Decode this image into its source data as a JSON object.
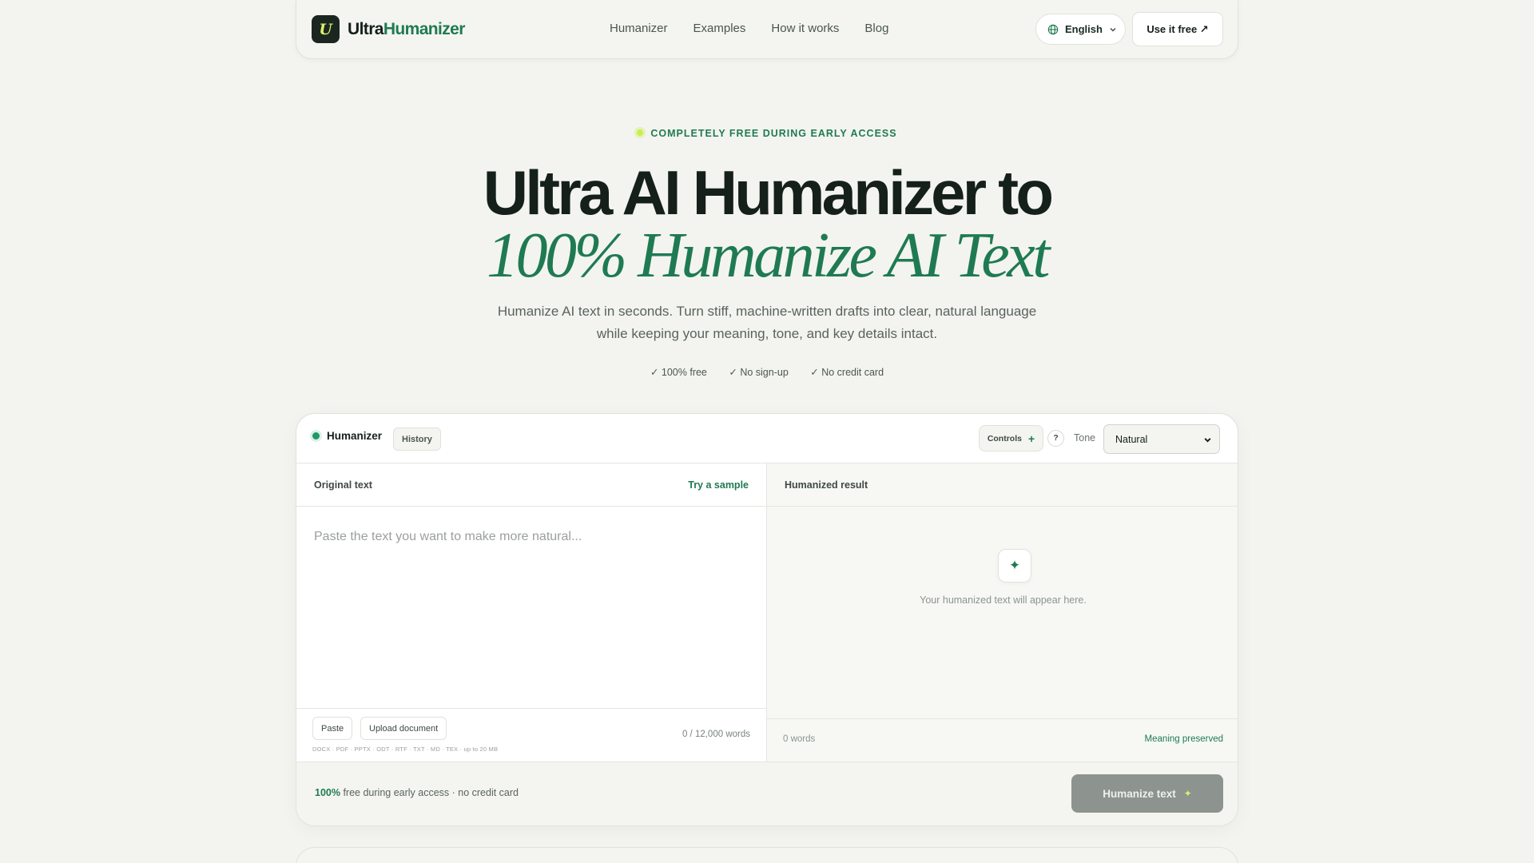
{
  "brand": {
    "logo_letter": "U",
    "name_part1": "Ultra",
    "name_part2": "Humanizer"
  },
  "nav": {
    "links": [
      "Humanizer",
      "Examples",
      "How it works",
      "Blog"
    ]
  },
  "header": {
    "language": "English",
    "cta": "Use it free ↗"
  },
  "hero": {
    "eyebrow": "COMPLETELY FREE DURING EARLY ACCESS",
    "title_line1": "Ultra AI Humanizer to",
    "title_line2": "100% Humanize AI Text",
    "subtitle": "Humanize AI text in seconds. Turn stiff, machine-written drafts into clear, natural language while keeping your meaning, tone, and key details intact.",
    "checks": [
      "✓ 100% free",
      "✓ No sign-up",
      "✓ No credit card"
    ]
  },
  "tool": {
    "tab": "Humanizer",
    "history": "History",
    "controls": "Controls",
    "help": "?",
    "tone_label": "Tone",
    "tone_value": "Natural",
    "original_label": "Original text",
    "try_sample": "Try a sample",
    "placeholder": "Paste the text you want to make more natural...",
    "paste": "Paste",
    "upload": "Upload document",
    "formats": "DOCX · PDF · PPTX · ODT · RTF · TXT · MD · TEX · up to 20 MB",
    "word_count": "0 / 12,000 words",
    "result_label": "Humanized result",
    "empty_text": "Your humanized text will appear here.",
    "result_words": "0 words",
    "meaning": "Meaning preserved",
    "free_strong": "100%",
    "free_rest": " free during early access · no credit card",
    "humanize": "Humanize text"
  },
  "colors": {
    "accent": "#1f7a52",
    "lime": "#c8ef4e",
    "bg": "#f3f4ef",
    "dark": "#15201a"
  },
  "icons": [
    "globe-icon",
    "chevron-down-icon",
    "sparkle-icon",
    "plus-icon"
  ]
}
